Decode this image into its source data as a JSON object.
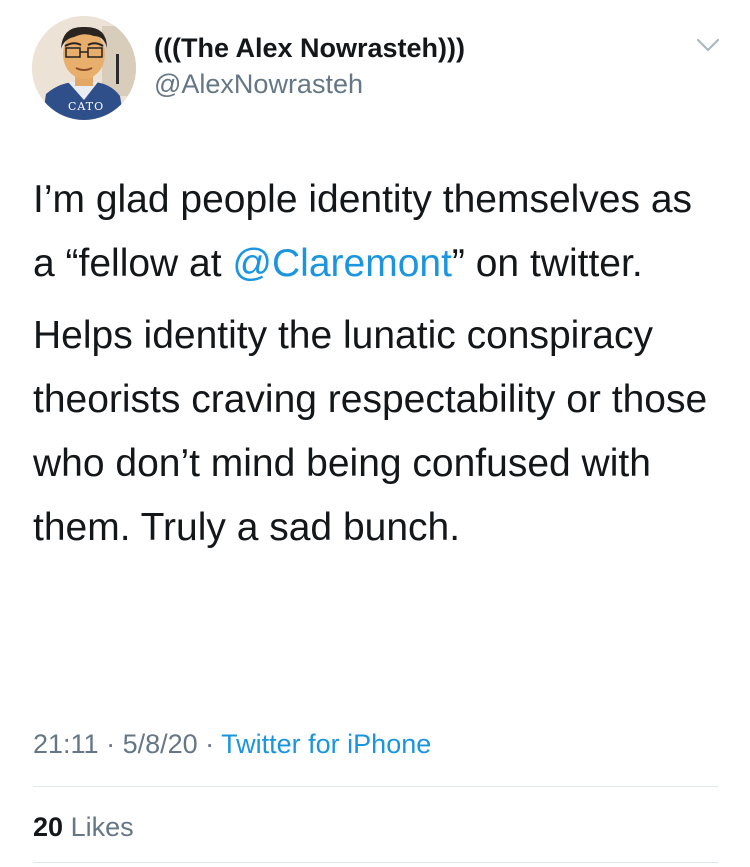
{
  "author": {
    "display_name": "(((The Alex Nowrasteh)))",
    "handle": "@AlexNowrasteh",
    "avatar_badge": "CATO"
  },
  "tweet": {
    "paragraph1_before": "I’m glad people identity themselves as a “fellow at ",
    "mention": "@Claremont",
    "paragraph1_after": "” on twitter.",
    "paragraph2": "Helps identity the lunatic conspiracy theorists craving respectability or those who don’t mind being confused with them. Truly a sad bunch."
  },
  "meta": {
    "time": "21:11",
    "separator1": " · ",
    "date": "5/8/20",
    "separator2": " · ",
    "source": "Twitter for iPhone"
  },
  "stats": {
    "likes_count": "20",
    "likes_label": "Likes"
  },
  "icons": {
    "menu": "chevron-down-icon",
    "avatar": "avatar"
  },
  "colors": {
    "link": "#1b95e0",
    "secondary_text": "#657786",
    "primary_text": "#14171a",
    "divider": "#e1e8ed"
  }
}
